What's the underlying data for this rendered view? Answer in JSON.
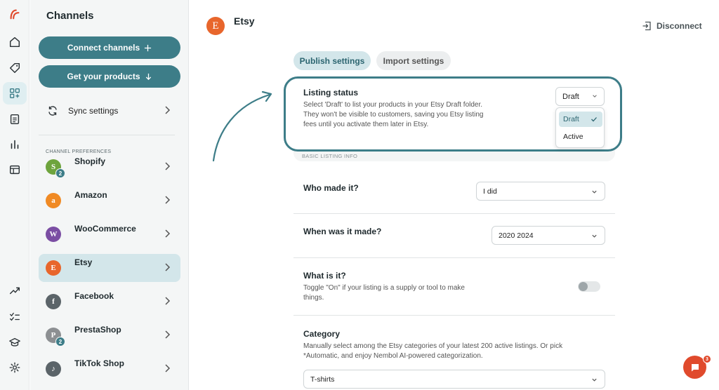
{
  "app": {
    "accent_color": "#3d7d88",
    "brand_color": "#e8662c"
  },
  "rail": {
    "icons": [
      "logo-icon",
      "home-icon",
      "tag-icon",
      "channels-icon",
      "orders-icon",
      "analytics-icon",
      "table-icon",
      "trending-icon",
      "checklist-icon",
      "academy-icon",
      "settings-icon"
    ]
  },
  "sidebar": {
    "title": "Channels",
    "connect_label": "Connect channels",
    "get_products_label": "Get your products",
    "sync_label": "Sync settings",
    "prefs_label": "CHANNEL PREFERENCES",
    "channels": [
      {
        "name": "Shopify",
        "badge": "2",
        "color": "#6ea43d",
        "glyph": "S"
      },
      {
        "name": "Amazon",
        "badge": "",
        "color": "#f08a24",
        "glyph": "a"
      },
      {
        "name": "WooCommerce",
        "badge": "",
        "color": "#7b4ea3",
        "glyph": "W"
      },
      {
        "name": "Etsy",
        "badge": "",
        "color": "#e8662c",
        "glyph": "E",
        "active": true
      },
      {
        "name": "Facebook",
        "badge": "",
        "color": "#5b6469",
        "glyph": "f"
      },
      {
        "name": "PrestaShop",
        "badge": "2",
        "color": "#8c8f92",
        "glyph": "P"
      },
      {
        "name": "TikTok Shop",
        "badge": "",
        "color": "#5b6469",
        "glyph": "♪"
      }
    ]
  },
  "header": {
    "logo_glyph": "E",
    "title": "Etsy",
    "disconnect_label": "Disconnect"
  },
  "tabs": [
    {
      "label": "Publish settings",
      "active": true
    },
    {
      "label": "Import settings",
      "active": false
    }
  ],
  "listing_status": {
    "title": "Listing status",
    "description": "Select 'Draft' to list your products in your Etsy Draft folder. They won't be visible to customers, saving you Etsy listing fees until you activate them later in Etsy.",
    "value": "Draft",
    "options": [
      "Draft",
      "Active"
    ]
  },
  "section_label": "BASIC LISTING INFO",
  "who_made": {
    "title": "Who made it?",
    "value": "I did"
  },
  "when_made": {
    "title": "When was it made?",
    "value": "2020 2024"
  },
  "what_is": {
    "title": "What is it?",
    "description": "Toggle \"On\" if your listing is a supply or tool to make things.",
    "toggle_on": false
  },
  "category": {
    "title": "Category",
    "description": "Manually select among the Etsy categories of your latest 200 active listings. Or pick *Automatic, and enjoy Nembol AI-powered categorization.",
    "value": "T-shirts"
  },
  "chat": {
    "badge": "3"
  }
}
